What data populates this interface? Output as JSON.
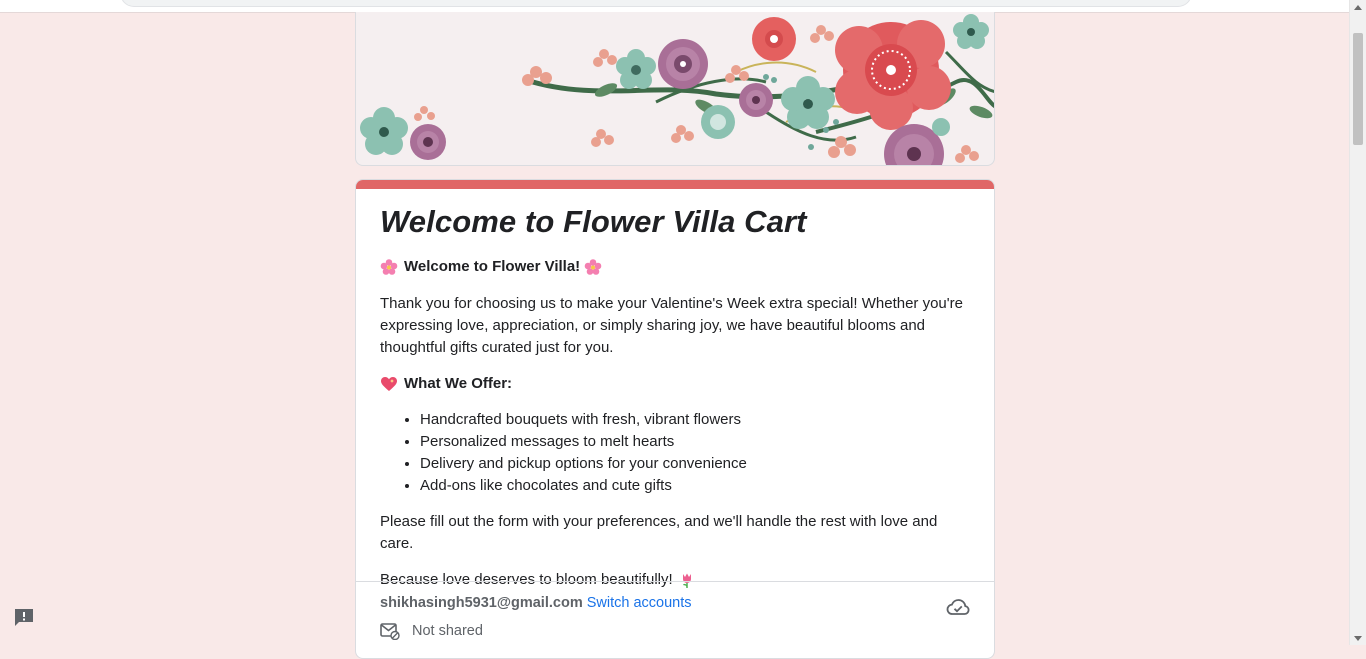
{
  "colors": {
    "page_background": "#f9e9e8",
    "accent": "#e06666",
    "link": "#1a73e8"
  },
  "form": {
    "title": "Welcome to Flower Villa Cart",
    "welcome_line": "Welcome to Flower Villa!",
    "intro": "Thank you for choosing us to make your Valentine's Week extra special! Whether you're expressing love, appreciation, or simply sharing joy, we have beautiful blooms and thoughtful gifts curated just for you.",
    "offer_heading": "What We Offer:",
    "offers": [
      "Handcrafted bouquets with fresh, vibrant flowers",
      "Personalized messages to melt hearts",
      "Delivery and pickup options for your convenience",
      "Add-ons like chocolates and cute gifts"
    ],
    "instruction": "Please fill out the form with your preferences, and we'll handle the rest with love and care.",
    "closing": "Because love deserves to bloom beautifully!"
  },
  "account": {
    "email": "shikhasingh5931@gmail.com",
    "switch_label": "Switch accounts",
    "share_status": "Not shared"
  },
  "icons": {
    "welcome": "cherry-blossom-icon",
    "offer": "sparkling-heart-icon",
    "closing": "tulip-icon",
    "save_status": "cloud-check-icon",
    "share": "mail-off-icon",
    "feedback": "report-feedback-icon"
  }
}
